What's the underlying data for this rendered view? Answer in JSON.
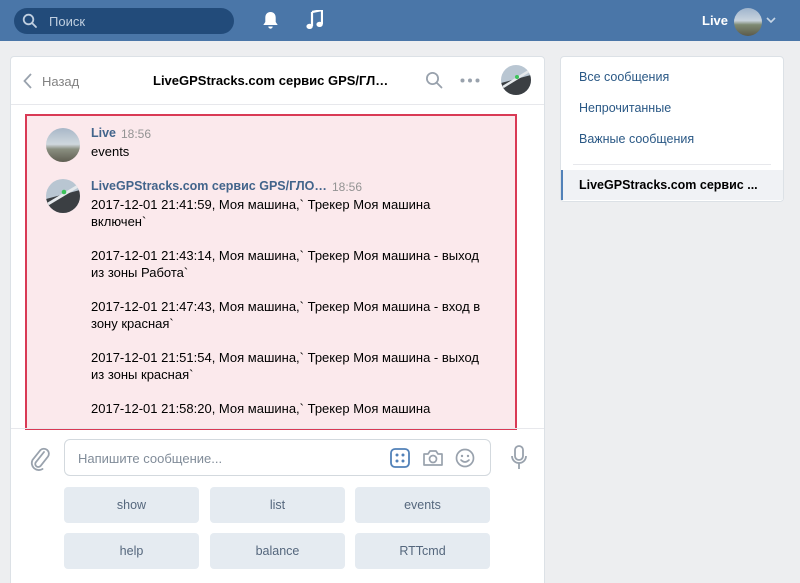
{
  "topbar": {
    "search_placeholder": "Поиск",
    "user_name": "Live"
  },
  "chat": {
    "back_label": "Назад",
    "title": "LiveGPStracks.com сервис GPS/ГЛОНАСС",
    "messages": [
      {
        "author": "Live",
        "time": "18:56",
        "lines": [
          "events"
        ]
      },
      {
        "author": "LiveGPStracks.com сервис GPS/ГЛОНА...",
        "time": "18:56",
        "lines": [
          "2017-12-01 21:41:59, Моя машина,` Трекер Моя машина",
          "включен`",
          "2017-12-01 21:43:14, Моя машина,` Трекер Моя машина - выход",
          "из зоны Работа`",
          "2017-12-01 21:47:43, Моя машина,` Трекер Моя машина - вход в",
          "зону красная`",
          "2017-12-01 21:51:54, Моя машина,` Трекер Моя машина - выход",
          "из зоны красная`",
          "2017-12-01 21:58:20, Моя машина,` Трекер Моя машина"
        ]
      }
    ],
    "input_placeholder": "Напишите сообщение...",
    "keyboard_buttons": [
      "show",
      "list",
      "events",
      "help",
      "balance",
      "RTTcmd"
    ]
  },
  "nav": {
    "items": [
      "Все сообщения",
      "Непрочитанные",
      "Важные сообщения"
    ],
    "active_chat": "LiveGPStracks.com сервис ..."
  },
  "colors": {
    "header": "#4a76a8",
    "highlight_border": "#d93a55",
    "highlight_bg": "#fbe9ec",
    "link": "#2a5885"
  }
}
